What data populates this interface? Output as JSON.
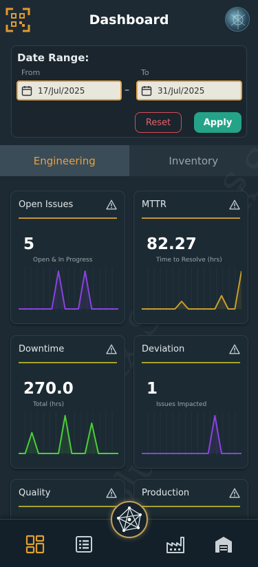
{
  "header": {
    "title": "Dashboard"
  },
  "date_range": {
    "label": "Date Range:",
    "from_label": "From",
    "to_label": "To",
    "from_value": "17/Jul/2025",
    "to_value": "31/Jul/2025",
    "reset_label": "Reset",
    "apply_label": "Apply"
  },
  "tabs": [
    {
      "label": "Engineering",
      "active": true
    },
    {
      "label": "Inventory",
      "active": false
    }
  ],
  "cards": [
    {
      "title": "Open Issues",
      "value": "5",
      "subtitle": "Open & In Progress",
      "color": "#8c42e6",
      "rule_color": "#c9962f",
      "series": [
        0,
        0,
        0,
        0,
        0,
        0,
        1,
        0,
        0,
        0,
        1,
        0,
        0,
        0,
        0,
        0
      ]
    },
    {
      "title": "MTTR",
      "value": "82.27",
      "subtitle": "Time to Resolve (hrs)",
      "color": "#c9a02a",
      "rule_color": "#c9962f",
      "series": [
        0,
        0,
        0,
        0,
        0,
        0,
        0.2,
        0,
        0,
        0,
        0,
        0,
        0.35,
        0,
        0,
        1
      ]
    },
    {
      "title": "Downtime",
      "value": "270.0",
      "subtitle": "Total (hrs)",
      "color": "#4ccf3a",
      "rule_color": "#a8a32c",
      "series": [
        0,
        0,
        0.55,
        0,
        0,
        0,
        0,
        1,
        0,
        0,
        0,
        0.8,
        0,
        0,
        0,
        0
      ]
    },
    {
      "title": "Deviation",
      "value": "1",
      "subtitle": "Issues Impacted",
      "color": "#8c42e6",
      "rule_color": "#a8a32c",
      "series": [
        0,
        0,
        0,
        0,
        0,
        0,
        0,
        0,
        0,
        0,
        0,
        1,
        0,
        0,
        0,
        0
      ]
    },
    {
      "title": "Quality",
      "rule_color": "#a8a32c"
    },
    {
      "title": "Production",
      "rule_color": "#a8a32c"
    }
  ],
  "nav": [
    {
      "icon": "dashboard-icon",
      "active": true
    },
    {
      "icon": "list-icon",
      "active": false
    },
    {
      "icon": "factory-icon",
      "active": false
    },
    {
      "icon": "warehouse-icon",
      "active": false
    }
  ],
  "colors": {
    "accent": "#e9a13f",
    "apply": "#24a388",
    "reset": "#d64d58"
  }
}
